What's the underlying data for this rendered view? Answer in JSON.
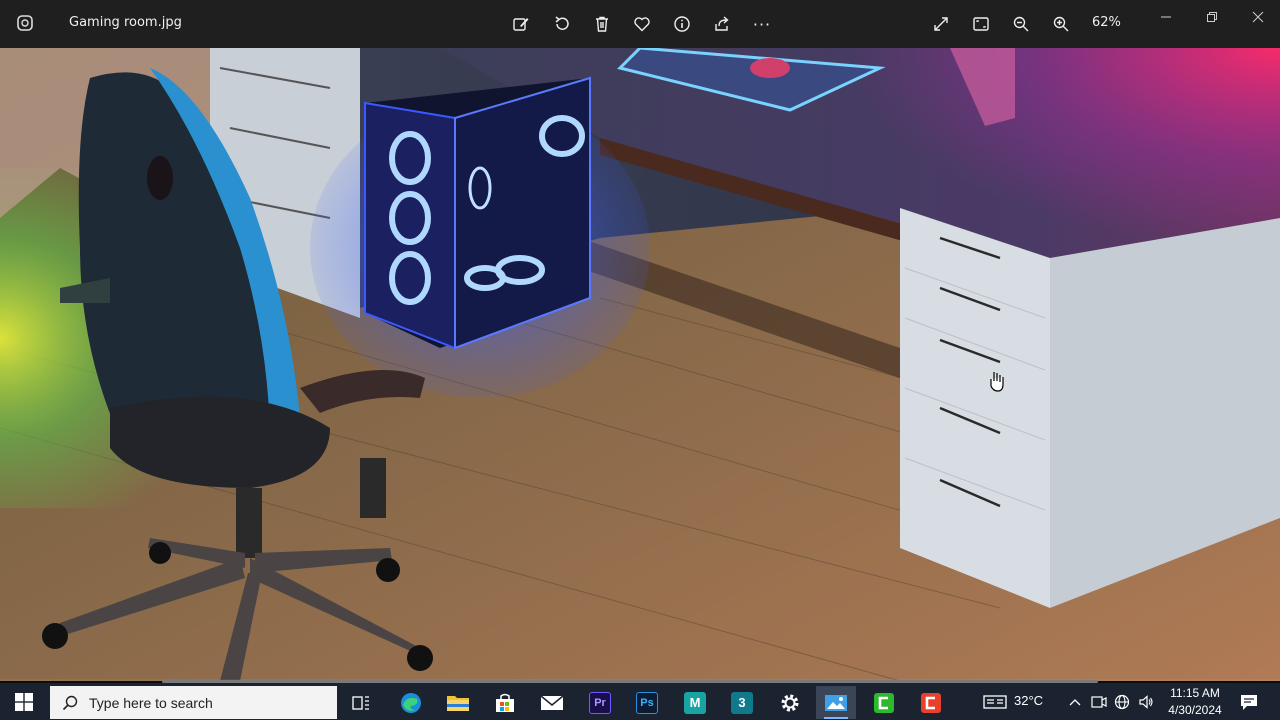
{
  "window": {
    "title": "Gaming room.jpg",
    "zoom": "62%"
  },
  "toolbar": {
    "icons": [
      "edit-image-icon",
      "rotate-icon",
      "delete-icon",
      "favorite-icon",
      "info-icon",
      "share-icon",
      "more-icon",
      "fullscreen-icon",
      "fit-to-window-icon",
      "zoom-out-icon",
      "zoom-in-icon"
    ],
    "more_label": "···"
  },
  "window_controls": [
    "minimize",
    "restore",
    "close"
  ],
  "taskbar": {
    "search_placeholder": "Type here to search",
    "apps": [
      {
        "name": "task-view",
        "label": ""
      },
      {
        "name": "edge",
        "label": ""
      },
      {
        "name": "file-explorer",
        "label": ""
      },
      {
        "name": "microsoft-store",
        "label": ""
      },
      {
        "name": "mail",
        "label": ""
      },
      {
        "name": "premiere-pro",
        "label": "Pr"
      },
      {
        "name": "photoshop",
        "label": "Ps"
      },
      {
        "name": "maya",
        "label": "M"
      },
      {
        "name": "3ds-max",
        "label": "3"
      },
      {
        "name": "settings",
        "label": ""
      },
      {
        "name": "photos",
        "label": ""
      },
      {
        "name": "camtasia-green",
        "label": ""
      },
      {
        "name": "camtasia-red",
        "label": ""
      }
    ],
    "active_app": "photos",
    "temperature": "32°C",
    "time": "11:15 AM",
    "date": "4/30/2024"
  },
  "colors": {
    "titlebar_bg": "#1f1f1f",
    "taskbar_bg": "#1c2330",
    "accent": "#7fb4ff"
  }
}
